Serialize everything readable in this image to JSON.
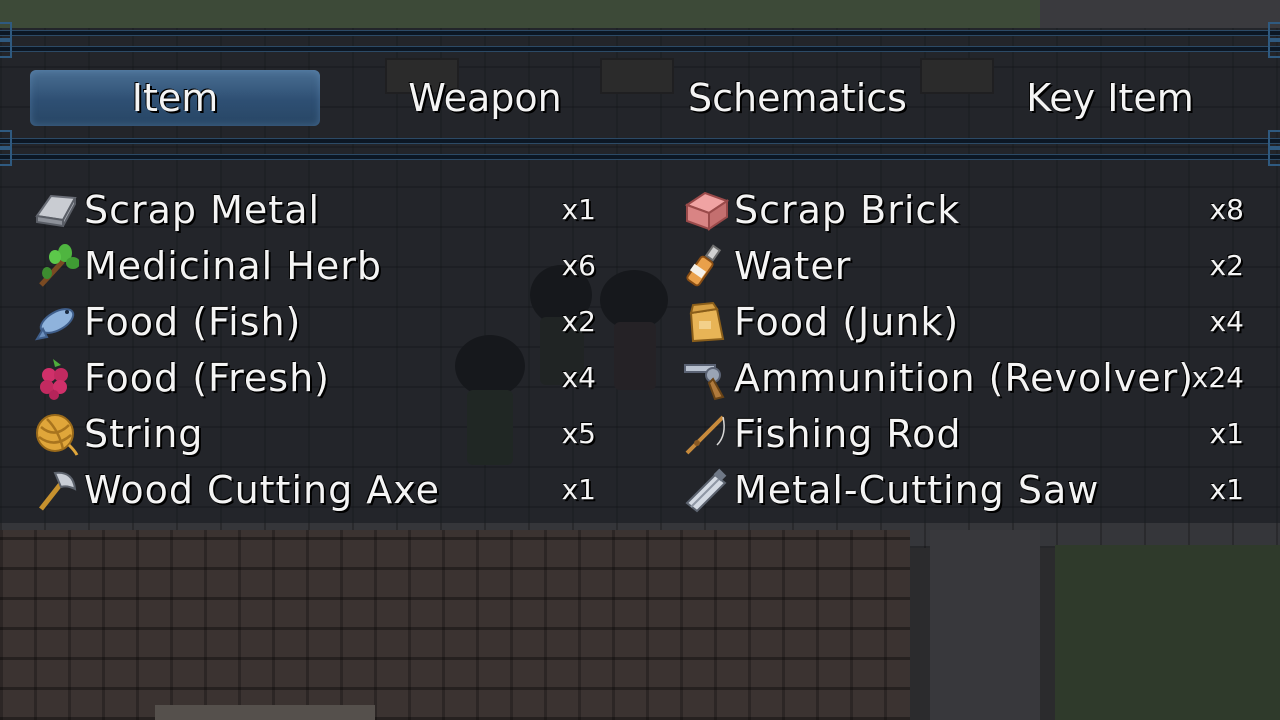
{
  "tabs": [
    {
      "label": "Item",
      "active": true
    },
    {
      "label": "Weapon",
      "active": false
    },
    {
      "label": "Schematics",
      "active": false
    },
    {
      "label": "Key Item",
      "active": false
    }
  ],
  "items_left": [
    {
      "name": "Scrap Metal",
      "qty": "x1",
      "icon": "scrap-metal-icon"
    },
    {
      "name": "Medicinal Herb",
      "qty": "x6",
      "icon": "herb-icon"
    },
    {
      "name": "Food (Fish)",
      "qty": "x2",
      "icon": "fish-icon"
    },
    {
      "name": "Food (Fresh)",
      "qty": "x4",
      "icon": "berry-icon"
    },
    {
      "name": "String",
      "qty": "x5",
      "icon": "yarn-ball-icon"
    },
    {
      "name": "Wood Cutting Axe",
      "qty": "x1",
      "icon": "axe-icon"
    }
  ],
  "items_right": [
    {
      "name": "Scrap Brick",
      "qty": "x8",
      "icon": "brick-icon"
    },
    {
      "name": "Water",
      "qty": "x2",
      "icon": "bottle-icon"
    },
    {
      "name": "Food (Junk)",
      "qty": "x4",
      "icon": "paper-bag-icon"
    },
    {
      "name": "Ammunition (Revolver)",
      "qty": "x24",
      "icon": "revolver-icon"
    },
    {
      "name": "Fishing Rod",
      "qty": "x1",
      "icon": "fishing-rod-icon"
    },
    {
      "name": "Metal-Cutting Saw",
      "qty": "x1",
      "icon": "saw-icon"
    }
  ],
  "colors": {
    "tab_active": "#3a5d83",
    "frame_line": "#2c4a66"
  }
}
